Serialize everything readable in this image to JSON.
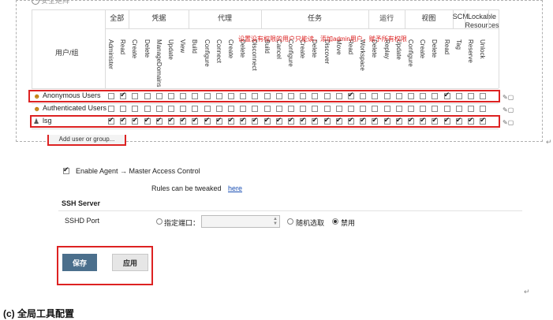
{
  "matrix": {
    "principal_header": "用户/组",
    "annotation": "设置没有权限的用户只能读，添加admin用户，赋予所有权限",
    "groups": [
      "全部",
      "凭据",
      "代理",
      "任务",
      "运行",
      "视图",
      "SCM",
      "Lockable Resources"
    ],
    "columns": [
      "Administer",
      "Read",
      "Create",
      "Delete",
      "ManageDomains",
      "Update",
      "View",
      "Build",
      "Configure",
      "Connect",
      "Create",
      "Delete",
      "Disconnect",
      "Build",
      "Cancel",
      "Configure",
      "Create",
      "Delete",
      "Discover",
      "Move",
      "Read",
      "Workspace",
      "Delete",
      "Replay",
      "Update",
      "Configure",
      "Create",
      "Delete",
      "Read",
      "Tag",
      "Reserve",
      "Unlock"
    ],
    "rows": [
      {
        "name": "Anonymous Users",
        "checked": [
          1,
          20,
          28
        ]
      },
      {
        "name": "Authenticated Users",
        "checked": []
      },
      {
        "name": "lsg",
        "checked": [
          0,
          1,
          2,
          3,
          4,
          5,
          6,
          7,
          8,
          9,
          10,
          11,
          12,
          13,
          14,
          15,
          16,
          17,
          18,
          19,
          20,
          21,
          22,
          23,
          24,
          25,
          26,
          27,
          28,
          29,
          30,
          31
        ]
      }
    ],
    "add_button": "Add user or group..."
  },
  "agent": {
    "checkbox_label": "Enable Agent → Master Access Control",
    "checked": true,
    "rules_text": "Rules can be tweaked ",
    "rules_link": "here"
  },
  "ssh": {
    "title": "SSH Server",
    "port_label": "SSHD Port",
    "opt_fixed": "指定端口：",
    "opt_random": "随机选取",
    "opt_disable": "禁用",
    "selected": "disable"
  },
  "buttons": {
    "save": "保存",
    "apply": "应用"
  },
  "footer": {
    "caption": "(c) 全局工具配置"
  }
}
